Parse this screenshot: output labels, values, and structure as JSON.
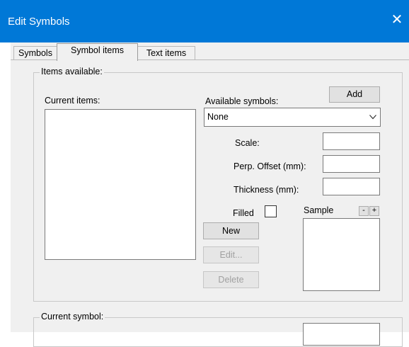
{
  "window": {
    "title": "Edit Symbols",
    "close_glyph": "✕"
  },
  "tabs": [
    {
      "label": "Symbols"
    },
    {
      "label": "Symbol items"
    },
    {
      "label": "Text items"
    }
  ],
  "items_available": {
    "group_label": "Items available:",
    "current_items_label": "Current items:",
    "available_symbols_label": "Available symbols:",
    "add_label": "Add",
    "available_symbols_value": "None",
    "scale_label": "Scale:",
    "perp_offset_label": "Perp. Offset (mm):",
    "thickness_label": "Thickness (mm):",
    "filled_label": "Filled",
    "sample_label": "Sample",
    "minus_label": "-",
    "plus_label": "+",
    "new_label": "New",
    "edit_label": "Edit...",
    "delete_label": "Delete"
  },
  "current_symbol": {
    "group_label": "Current symbol:"
  }
}
